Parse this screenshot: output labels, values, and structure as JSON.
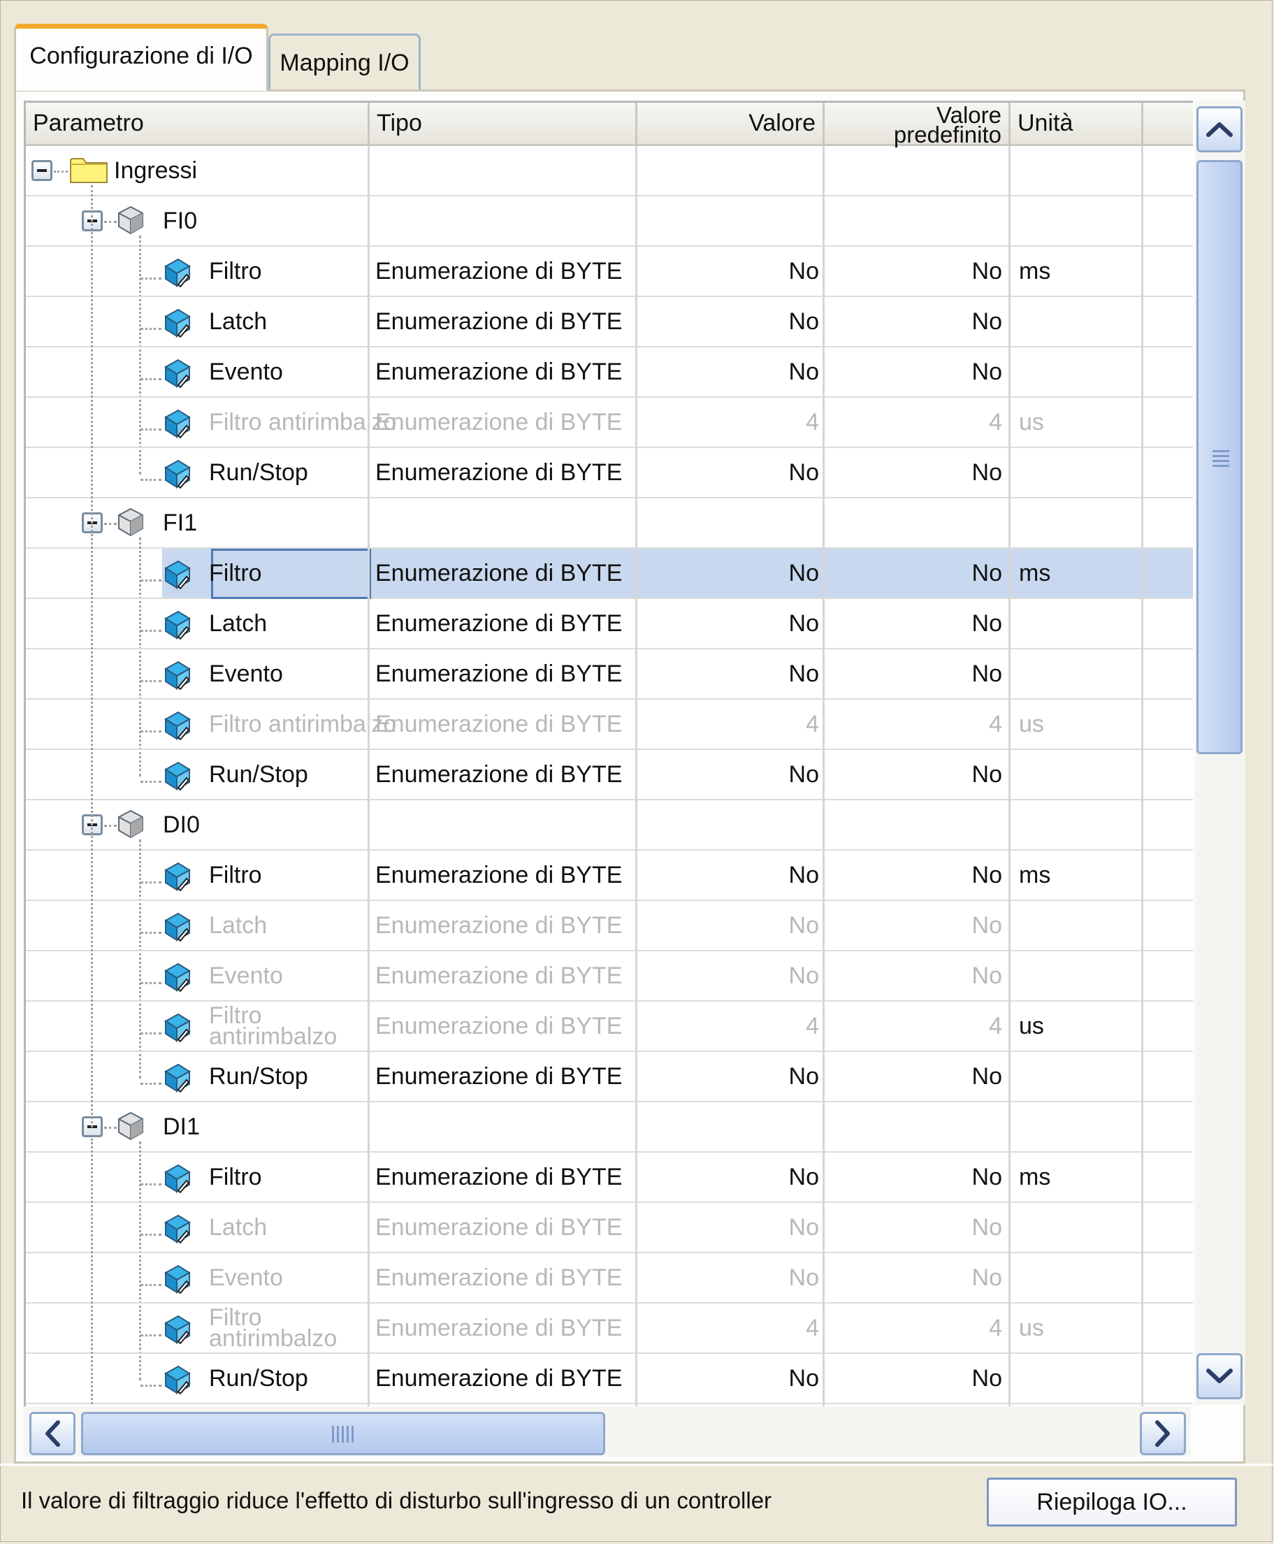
{
  "tabs": [
    {
      "label": "Configurazione di I/O",
      "active": true
    },
    {
      "label": "Mapping I/O",
      "active": false
    }
  ],
  "columns": {
    "parametro": "Parametro",
    "tipo": "Tipo",
    "valore": "Valore",
    "valore_predefinito_1": "Valore",
    "valore_predefinito_2": "predefinito",
    "unita": "Unità"
  },
  "tree": {
    "root": "Ingressi",
    "groups": [
      {
        "name": "FI0",
        "rows": [
          {
            "param": "Filtro",
            "type": "Enumerazione di BYTE",
            "value": "No",
            "default": "No",
            "unit": "ms",
            "dim": false
          },
          {
            "param": "Latch",
            "type": "Enumerazione di BYTE",
            "value": "No",
            "default": "No",
            "unit": "",
            "dim": false
          },
          {
            "param": "Evento",
            "type": "Enumerazione di BYTE",
            "value": "No",
            "default": "No",
            "unit": "",
            "dim": false
          },
          {
            "param": "Filtro antirimbalzo",
            "type": "Enumerazione di BYTE",
            "value": "4",
            "default": "4",
            "unit": "us",
            "dim": true
          },
          {
            "param": "Run/Stop",
            "type": "Enumerazione di BYTE",
            "value": "No",
            "default": "No",
            "unit": "",
            "dim": false
          }
        ]
      },
      {
        "name": "FI1",
        "rows": [
          {
            "param": "Filtro",
            "type": "Enumerazione di BYTE",
            "value": "No",
            "default": "No",
            "unit": "ms",
            "dim": false,
            "selected": true
          },
          {
            "param": "Latch",
            "type": "Enumerazione di BYTE",
            "value": "No",
            "default": "No",
            "unit": "",
            "dim": false
          },
          {
            "param": "Evento",
            "type": "Enumerazione di BYTE",
            "value": "No",
            "default": "No",
            "unit": "",
            "dim": false
          },
          {
            "param": "Filtro antirimbalzo",
            "type": "Enumerazione di BYTE",
            "value": "4",
            "default": "4",
            "unit": "us",
            "dim": true
          },
          {
            "param": "Run/Stop",
            "type": "Enumerazione di BYTE",
            "value": "No",
            "default": "No",
            "unit": "",
            "dim": false
          }
        ]
      },
      {
        "name": "DI0",
        "rows": [
          {
            "param": "Filtro",
            "type": "Enumerazione di BYTE",
            "value": "No",
            "default": "No",
            "unit": "ms",
            "dim": false
          },
          {
            "param": "Latch",
            "type": "Enumerazione di BYTE",
            "value": "No",
            "default": "No",
            "unit": "",
            "dim": true
          },
          {
            "param": "Evento",
            "type": "Enumerazione di BYTE",
            "value": "No",
            "default": "No",
            "unit": "",
            "dim": true
          },
          {
            "param": "Filtro antirimbalzo",
            "type": "Enumerazione di BYTE",
            "value": "4",
            "default": "4",
            "unit": "us",
            "dim": true,
            "wrap": true,
            "unit_dark": true
          },
          {
            "param": "Run/Stop",
            "type": "Enumerazione di BYTE",
            "value": "No",
            "default": "No",
            "unit": "",
            "dim": false
          }
        ]
      },
      {
        "name": "DI1",
        "rows": [
          {
            "param": "Filtro",
            "type": "Enumerazione di BYTE",
            "value": "No",
            "default": "No",
            "unit": "ms",
            "dim": false
          },
          {
            "param": "Latch",
            "type": "Enumerazione di BYTE",
            "value": "No",
            "default": "No",
            "unit": "",
            "dim": true
          },
          {
            "param": "Evento",
            "type": "Enumerazione di BYTE",
            "value": "No",
            "default": "No",
            "unit": "",
            "dim": true
          },
          {
            "param": "Filtro antirimbalzo",
            "type": "Enumerazione di BYTE",
            "value": "4",
            "default": "4",
            "unit": "us",
            "dim": true,
            "wrap": true
          },
          {
            "param": "Run/Stop",
            "type": "Enumerazione di BYTE",
            "value": "No",
            "default": "No",
            "unit": "",
            "dim": false
          }
        ]
      }
    ]
  },
  "description": "Il valore di filtraggio riduce l'effetto di disturbo sull'ingresso di un controller",
  "summary_button": "Riepiloga IO...",
  "icons": {
    "expander": "collapse-minus-icon",
    "folder": "folder-icon",
    "group": "device-cube-icon",
    "param": "parameter-cube-icon",
    "scroll_up": "chevron-up-icon",
    "scroll_down": "chevron-down-icon",
    "scroll_left": "chevron-left-icon",
    "scroll_right": "chevron-right-icon"
  },
  "colors": {
    "tab_accent": "#f2a82a",
    "selection": "#c8d8ee",
    "selection_border": "#4d79b6",
    "dim_text": "#b8b8b8",
    "folder": "#fff27a",
    "cube": "#2aa6e0"
  }
}
